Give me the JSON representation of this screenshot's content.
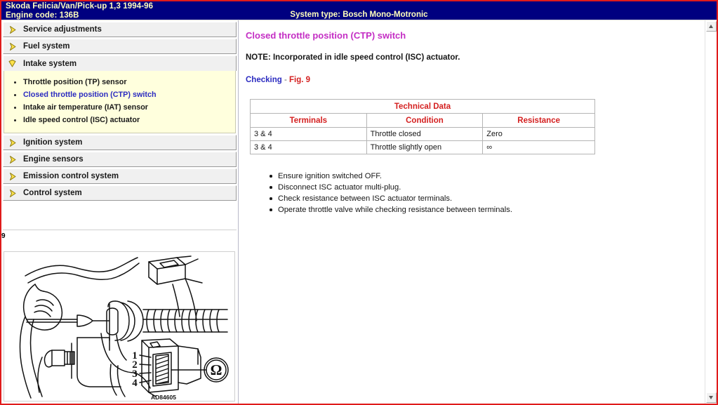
{
  "header": {
    "vehicle": "Skoda   Felicia/Van/Pick-up  1,3  1994-96",
    "engine_code": "Engine code: 136B",
    "system_type": "System type: Bosch Mono-Motronic",
    "bg_color": "#000080",
    "text_color": "#ffffbb"
  },
  "sidebar": {
    "groups": [
      {
        "label": "Service adjustments",
        "expanded": false,
        "icon": "chevron-right-icon"
      },
      {
        "label": "Fuel system",
        "expanded": false,
        "icon": "chevron-right-icon"
      },
      {
        "label": "Intake system",
        "expanded": true,
        "icon": "chevron-down-icon",
        "items": [
          {
            "label": "Throttle position (TP) sensor",
            "active": false
          },
          {
            "label": "Closed throttle position (CTP) switch",
            "active": true
          },
          {
            "label": "Intake air temperature (IAT) sensor",
            "active": false
          },
          {
            "label": "Idle speed control (ISC) actuator",
            "active": false
          }
        ]
      },
      {
        "label": "Ignition system",
        "expanded": false,
        "icon": "chevron-right-icon"
      },
      {
        "label": "Engine sensors",
        "expanded": false,
        "icon": "chevron-right-icon"
      },
      {
        "label": "Emission control system",
        "expanded": false,
        "icon": "chevron-right-icon"
      },
      {
        "label": "Control system",
        "expanded": false,
        "icon": "chevron-right-icon"
      }
    ]
  },
  "figure": {
    "number": "9",
    "caption_code": "AD84605",
    "terminal_labels": [
      "1",
      "2",
      "3",
      "4"
    ],
    "meter_symbol": "Ω"
  },
  "main": {
    "title": "Closed throttle position (CTP) switch",
    "title_color": "#c42ec4",
    "note": "NOTE: Incorporated in idle speed control (ISC) actuator.",
    "checking": {
      "word": "Checking",
      "dash": " - ",
      "figure_ref": "Fig. 9",
      "word_color": "#2b2bc0",
      "figure_color": "#d42020"
    },
    "table": {
      "title": "Technical Data",
      "title_color": "#d42020",
      "columns": [
        "Terminals",
        "Condition",
        "Resistance"
      ],
      "rows": [
        [
          "3 & 4",
          "Throttle closed",
          "Zero"
        ],
        [
          "3 & 4",
          "Throttle slightly open",
          "∞"
        ]
      ]
    },
    "steps": [
      "Ensure ignition switched OFF.",
      "Disconnect ISC actuator multi-plug.",
      "Check resistance between ISC actuator terminals.",
      "Operate throttle valve while checking resistance between terminals."
    ]
  },
  "scrollbar": {
    "up_icon": "arrow-up-icon",
    "down_icon": "arrow-down-icon"
  }
}
